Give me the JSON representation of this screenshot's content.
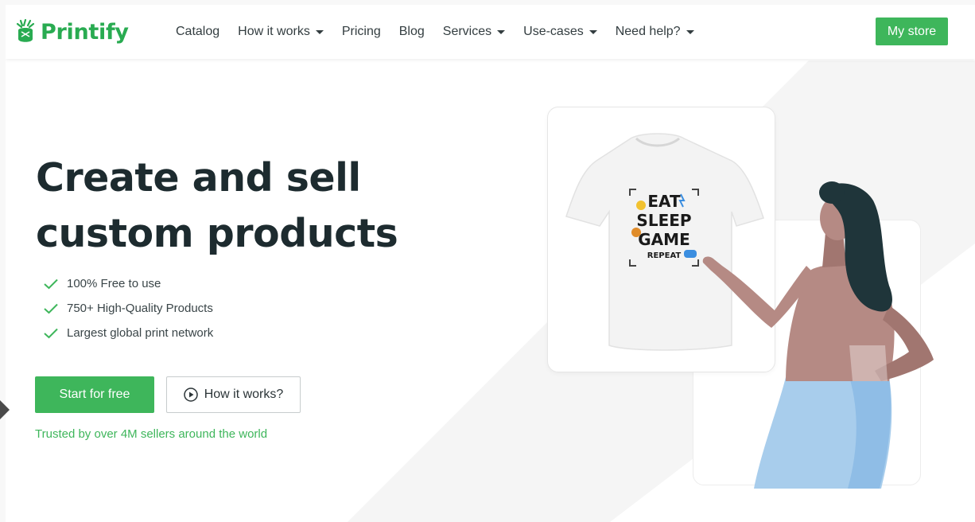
{
  "brand": {
    "name": "Printify",
    "color": "#29ab51"
  },
  "nav": {
    "items": [
      {
        "label": "Catalog",
        "dropdown": false
      },
      {
        "label": "How it works",
        "dropdown": true
      },
      {
        "label": "Pricing",
        "dropdown": false
      },
      {
        "label": "Blog",
        "dropdown": false
      },
      {
        "label": "Services",
        "dropdown": true
      },
      {
        "label": "Use-cases",
        "dropdown": true
      },
      {
        "label": "Need help?",
        "dropdown": true
      }
    ],
    "cta_label": "My store"
  },
  "hero": {
    "title_line1": "Create and sell",
    "title_line2": "custom products",
    "features": [
      "100% Free to use",
      "750+ High-Quality Products",
      "Largest global print network"
    ],
    "primary_cta": "Start for free",
    "secondary_cta": "How it works?",
    "trust_text": "Trusted by over 4M sellers around the world"
  },
  "shirt_print": {
    "lines": [
      "EAT",
      "SLEEP",
      "GAME",
      "REPEAT"
    ]
  },
  "colors": {
    "accent": "#3eb65b",
    "title": "#1d2b2f",
    "skin": "#b58a84",
    "hair": "#1f353a",
    "skirt": "#a8cdec"
  },
  "icons": {
    "check": "check-icon",
    "play": "play-circle-icon",
    "caret": "chevron-down-icon"
  }
}
